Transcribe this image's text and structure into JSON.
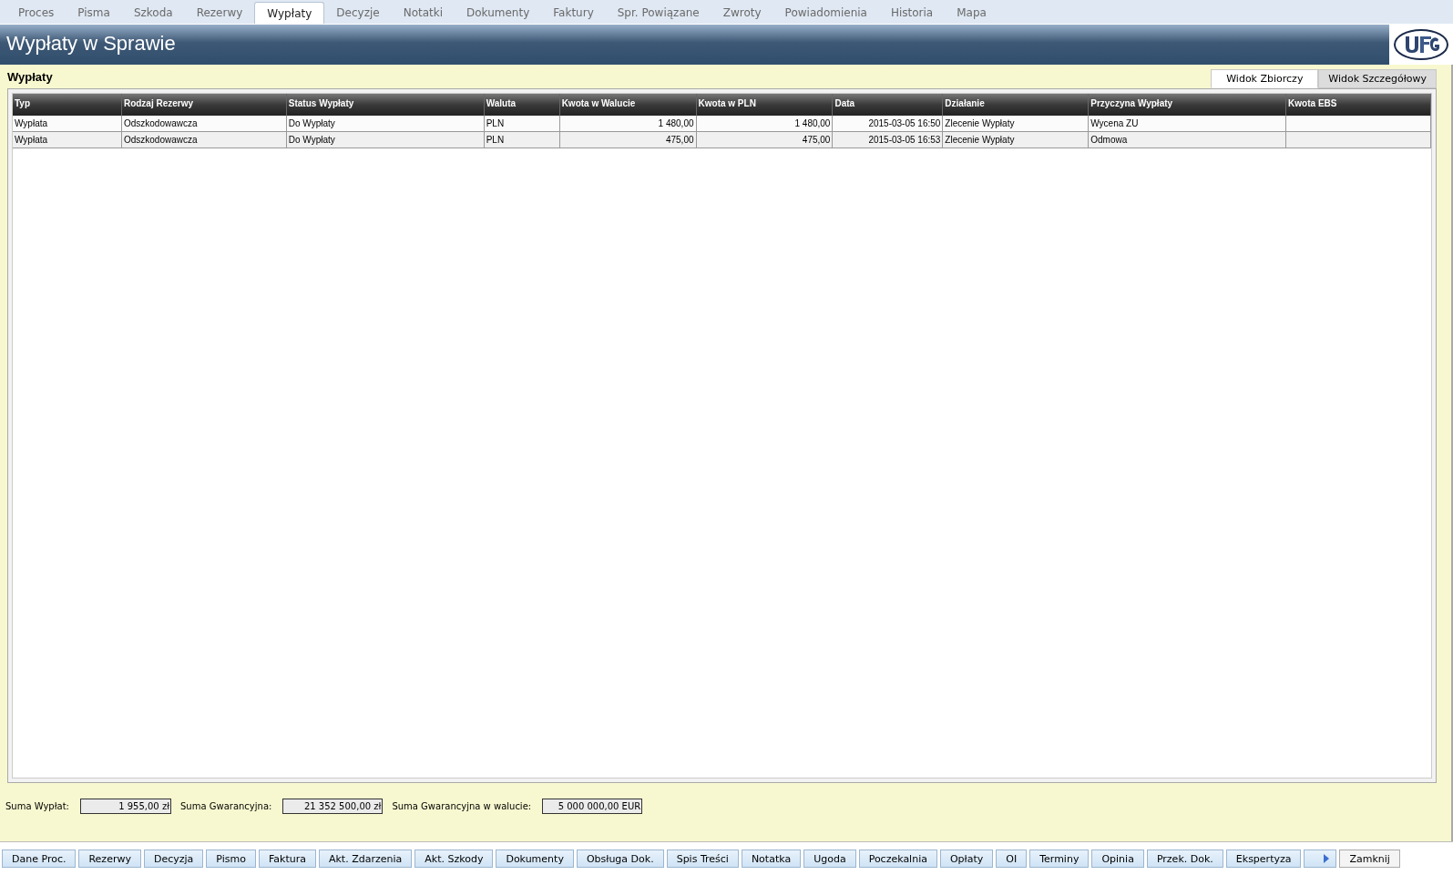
{
  "tabs": [
    {
      "label": "Proces",
      "selected": false
    },
    {
      "label": "Pisma",
      "selected": false
    },
    {
      "label": "Szkoda",
      "selected": false
    },
    {
      "label": "Rezerwy",
      "selected": false
    },
    {
      "label": "Wypłaty",
      "selected": true
    },
    {
      "label": "Decyzje",
      "selected": false
    },
    {
      "label": "Notatki",
      "selected": false
    },
    {
      "label": "Dokumenty",
      "selected": false
    },
    {
      "label": "Faktury",
      "selected": false
    },
    {
      "label": "Spr. Powiązane",
      "selected": false
    },
    {
      "label": "Zwroty",
      "selected": false
    },
    {
      "label": "Powiadomienia",
      "selected": false
    },
    {
      "label": "Historia",
      "selected": false
    },
    {
      "label": "Mapa",
      "selected": false
    }
  ],
  "header": {
    "title": "Wypłaty w Sprawie"
  },
  "panel": {
    "title": "Wypłaty"
  },
  "view_tabs": [
    {
      "label": "Widok Zbiorczy",
      "selected": true
    },
    {
      "label": "Widok Szczegółowy",
      "selected": false
    }
  ],
  "table": {
    "columns": [
      {
        "label": "Typ",
        "kind": "text"
      },
      {
        "label": "Rodzaj Rezerwy",
        "kind": "text"
      },
      {
        "label": "Status Wypłaty",
        "kind": "text"
      },
      {
        "label": "Waluta",
        "kind": "text"
      },
      {
        "label": "Kwota w Walucie",
        "kind": "number"
      },
      {
        "label": "Kwota w PLN",
        "kind": "number"
      },
      {
        "label": "Data",
        "kind": "number"
      },
      {
        "label": "Działanie",
        "kind": "text"
      },
      {
        "label": "Przyczyna Wypłaty",
        "kind": "text"
      },
      {
        "label": "Kwota EBS",
        "kind": "text"
      }
    ],
    "rows": [
      [
        "Wypłata",
        "Odszkodowawcza",
        "Do Wypłaty",
        "PLN",
        "1 480,00",
        "1 480,00",
        "2015-03-05 16:50",
        "Zlecenie Wypłaty",
        "Wycena ZU",
        ""
      ],
      [
        "Wypłata",
        "Odszkodowawcza",
        "Do Wypłaty",
        "PLN",
        "475,00",
        "475,00",
        "2015-03-05 16:53",
        "Zlecenie Wypłaty",
        "Odmowa",
        ""
      ]
    ]
  },
  "sums": [
    {
      "label": "Suma Wypłat:",
      "value": "1 955,00 zł"
    },
    {
      "label": "Suma Gwarancyjna:",
      "value": "21 352 500,00 zł"
    },
    {
      "label": "Suma Gwarancyjna w walucie:",
      "value": "5 000 000,00 EUR"
    }
  ],
  "buttons": [
    "Dane Proc.",
    "Rezerwy",
    "Decyzja",
    "Pismo",
    "Faktura",
    "Akt. Zdarzenia",
    "Akt. Szkody",
    "Dokumenty",
    "Obsługa Dok.",
    "Spis Treści",
    "Notatka",
    "Ugoda",
    "Poczekalnia",
    "Opłaty",
    "OI",
    "Terminy",
    "Opinia",
    "Przek. Dok.",
    "Ekspertyza"
  ],
  "close_button": "Zamknij"
}
